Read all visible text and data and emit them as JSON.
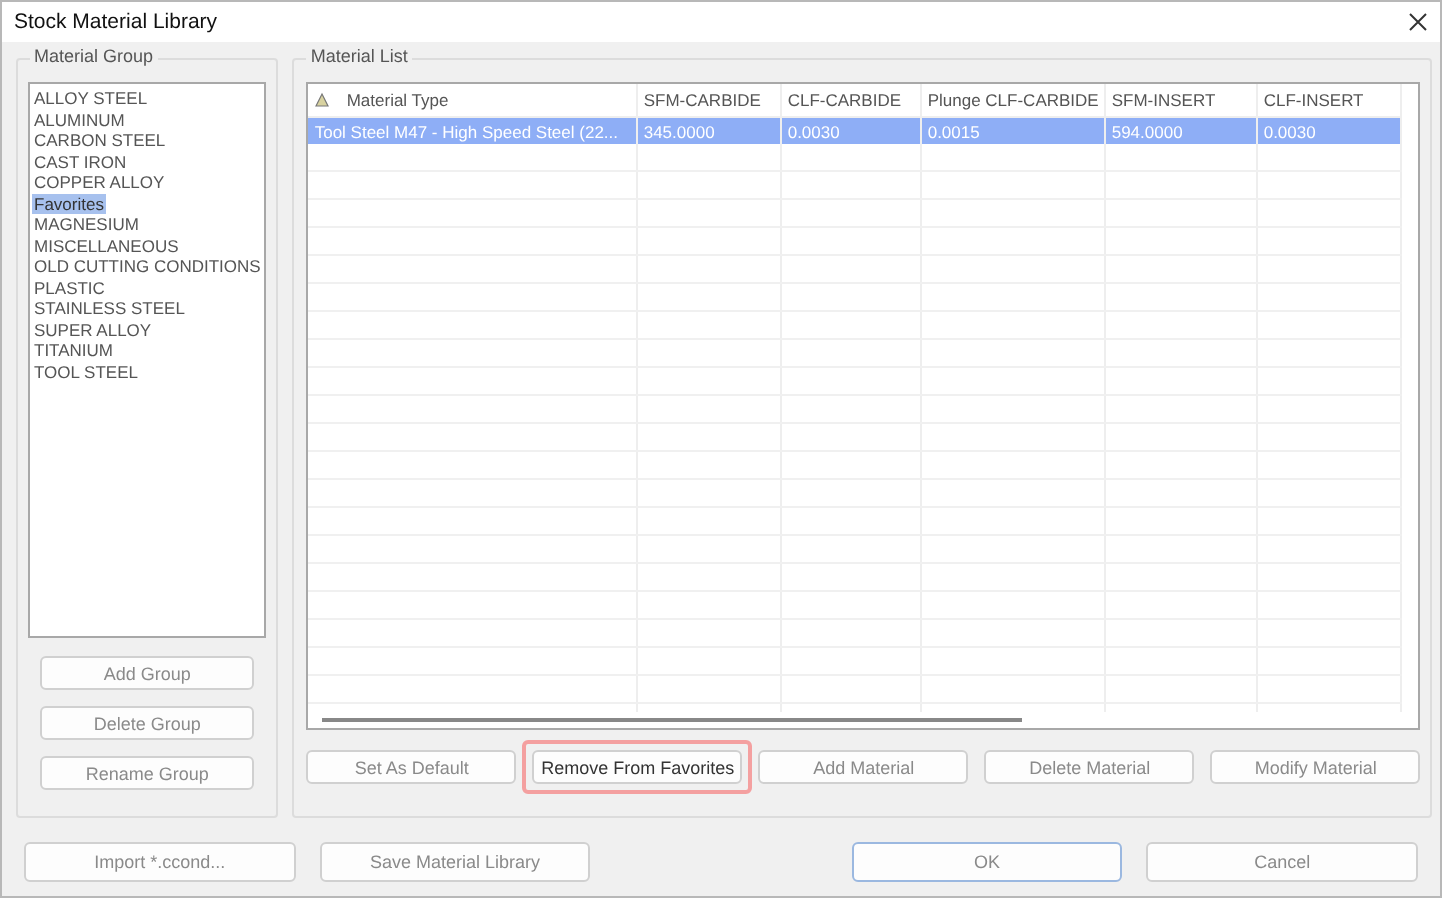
{
  "window": {
    "title": "Stock Material Library"
  },
  "material_group": {
    "title": "Material Group",
    "items": [
      {
        "label": "ALLOY STEEL",
        "selected": false
      },
      {
        "label": "ALUMINUM",
        "selected": false
      },
      {
        "label": "CARBON STEEL",
        "selected": false
      },
      {
        "label": "CAST IRON",
        "selected": false
      },
      {
        "label": "COPPER ALLOY",
        "selected": false
      },
      {
        "label": "Favorites",
        "selected": true
      },
      {
        "label": "MAGNESIUM",
        "selected": false
      },
      {
        "label": "MISCELLANEOUS",
        "selected": false
      },
      {
        "label": "OLD CUTTING CONDITIONS",
        "selected": false
      },
      {
        "label": "PLASTIC",
        "selected": false
      },
      {
        "label": "STAINLESS STEEL",
        "selected": false
      },
      {
        "label": "SUPER ALLOY",
        "selected": false
      },
      {
        "label": "TITANIUM",
        "selected": false
      },
      {
        "label": "TOOL STEEL",
        "selected": false
      }
    ],
    "buttons": [
      {
        "label": "Add Group",
        "disabled": true,
        "highlighted": false
      },
      {
        "label": "Delete Group",
        "disabled": true,
        "highlighted": false
      },
      {
        "label": "Rename Group",
        "disabled": true,
        "highlighted": false
      }
    ]
  },
  "material_list": {
    "title": "Material List",
    "columns": [
      "Material Type",
      "SFM-CARBIDE",
      "CLF-CARBIDE",
      "Plunge CLF-CARBIDE",
      "SFM-INSERT",
      "CLF-INSERT"
    ],
    "rows": [
      {
        "cells": [
          "Tool Steel M47 - High Speed Steel (22...",
          "345.0000",
          "0.0030",
          "0.0015",
          "594.0000",
          "0.0030"
        ],
        "selected": true
      }
    ],
    "buttons": [
      {
        "label": "Set As Default",
        "disabled": true,
        "highlighted": false
      },
      {
        "label": "Remove From Favorites",
        "disabled": false,
        "highlighted": true
      },
      {
        "label": "Add Material",
        "disabled": true,
        "highlighted": false
      },
      {
        "label": "Delete Material",
        "disabled": true,
        "highlighted": false
      },
      {
        "label": "Modify Material",
        "disabled": true,
        "highlighted": false
      }
    ]
  },
  "footer_buttons": [
    {
      "label": "Import *.ccond...",
      "default": false
    },
    {
      "label": "Save Material Library",
      "default": false
    },
    {
      "label": "OK",
      "default": true
    },
    {
      "label": "Cancel",
      "default": false
    }
  ]
}
